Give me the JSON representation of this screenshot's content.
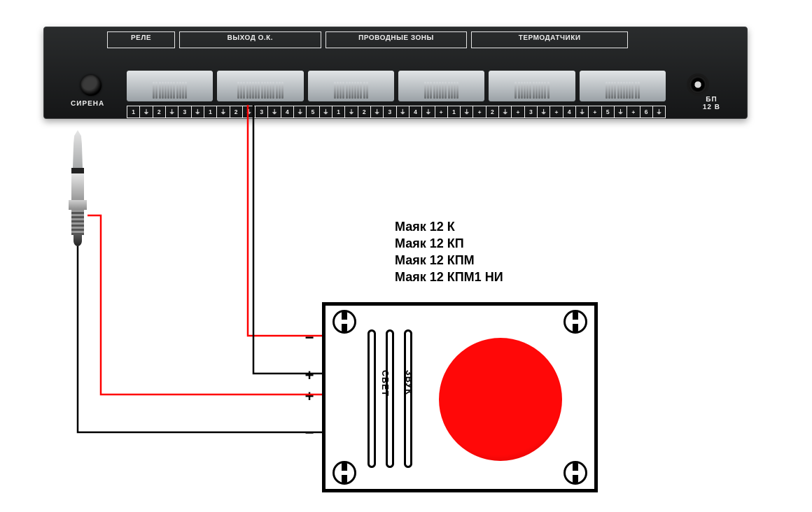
{
  "device": {
    "group_labels": [
      "РЕЛЕ",
      "ВЫХОД О.К.",
      "ПРОВОДНЫЕ ЗОНЫ",
      "ТЕРМОДАТЧИКИ"
    ],
    "siren_label": "СИРЕНА",
    "power_label": "БП\n12 В",
    "strip": [
      "1",
      "⏚",
      "2",
      "⏚",
      "3",
      "⏚",
      "1",
      "⏚",
      "2",
      "⏚",
      "3",
      "⏚",
      "4",
      "⏚",
      "5",
      "⏚",
      "1",
      "⏚",
      "2",
      "⏚",
      "3",
      "⏚",
      "4",
      "⏚",
      "+",
      "1",
      "⏚",
      "+",
      "2",
      "⏚",
      "+",
      "3",
      "⏚",
      "+",
      "4",
      "⏚",
      "+",
      "5",
      "⏚",
      "+",
      "6",
      "⏚"
    ]
  },
  "mayak": {
    "lines": [
      "Маяк 12 К",
      "Маяк 12 КП",
      "Маяк 12 КПМ",
      "Маяк 12 КПМ1 НИ"
    ],
    "svet": "СВЕТ",
    "zvuk": "ЗВУК"
  },
  "polarity": {
    "plus": "+",
    "minus": "−"
  },
  "colors": {
    "wire_red": "#ff0000",
    "wire_black": "#000000"
  }
}
